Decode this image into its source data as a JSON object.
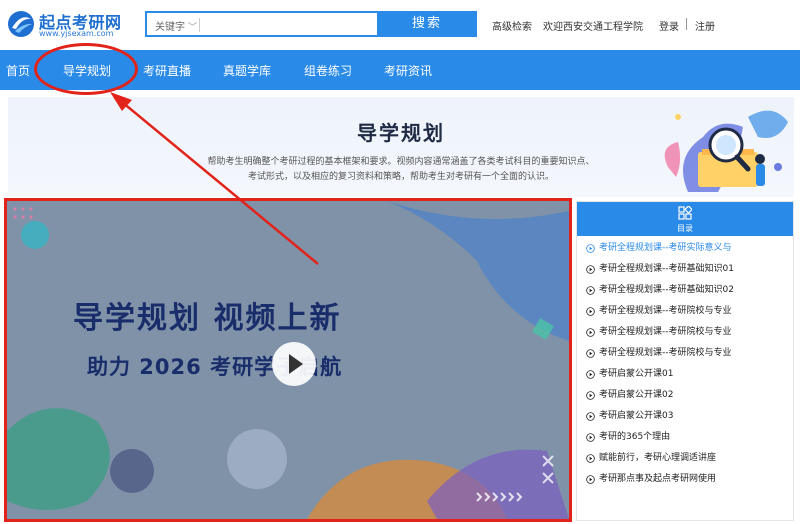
{
  "header": {
    "logo_title": "起点考研网",
    "logo_url": "www.yjsexam.com",
    "search_select": "关键字",
    "search_placeholder": "",
    "search_button": "搜索",
    "advanced_search": "高级检索",
    "welcome": "欢迎西安交通工程学院",
    "login": "登录",
    "register": "注册"
  },
  "nav": {
    "items": [
      "首页",
      "导学规划",
      "考研直播",
      "真题学库",
      "组卷练习",
      "考研资讯"
    ]
  },
  "banner": {
    "title": "导学规划",
    "desc_line1": "帮助考生明确整个考研过程的基本框架和要求。视频内容通常涵盖了各类考试科目的重要知识点、",
    "desc_line2": "考试形式，以及相应的复习资料和策略，帮助考生对考研有一个全面的认识。"
  },
  "video": {
    "headline": "导学规划 视频上新",
    "subline": "助力 2026 考研学子启航"
  },
  "catalog": {
    "title": "目录",
    "items": [
      "考研全程规划课--考研实际意义与",
      "考研全程规划课--考研基础知识01",
      "考研全程规划课--考研基础知识02",
      "考研全程规划课--考研院校与专业",
      "考研全程规划课--考研院校与专业",
      "考研全程规划课--考研院校与专业",
      "考研启蒙公开课01",
      "考研启蒙公开课02",
      "考研启蒙公开课03",
      "考研的365个理由",
      "赋能前行，考研心理调适讲座",
      "考研那点事及起点考研网使用"
    ]
  },
  "colors": {
    "brand_blue": "#2a8ae8",
    "annotation_red": "#e2231a"
  }
}
